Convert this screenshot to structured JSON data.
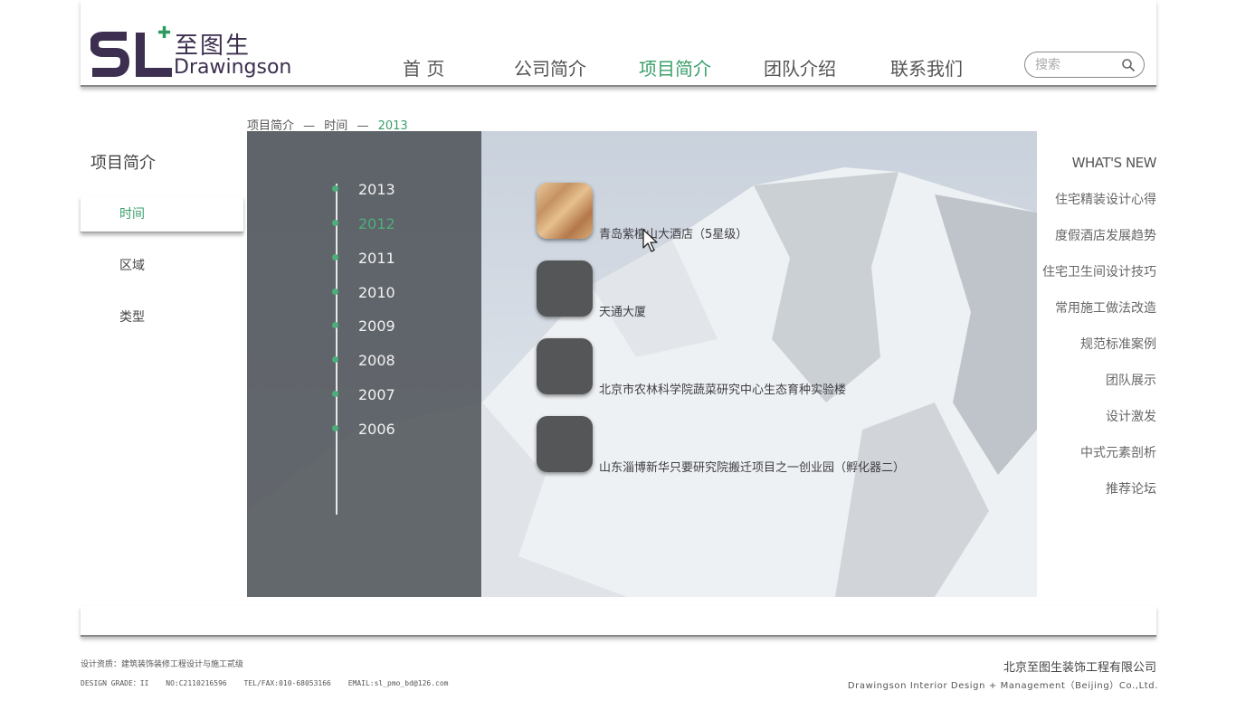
{
  "header": {
    "logo_cn": "至图生",
    "logo_en": "Drawingson",
    "nav": [
      {
        "label": "首 页"
      },
      {
        "label": "公司简介"
      },
      {
        "label": "项目简介"
      },
      {
        "label": "团队介绍"
      },
      {
        "label": "联系我们"
      }
    ],
    "active_nav": "项目简介",
    "search_placeholder": "搜索"
  },
  "breadcrumb": {
    "root": "项目简介",
    "sep": "—",
    "middle": "时间",
    "current": "2013"
  },
  "left_sidebar": {
    "title": "项目简介",
    "items": [
      {
        "label": "时间"
      },
      {
        "label": "区域"
      },
      {
        "label": "类型"
      }
    ],
    "active": "时间"
  },
  "timeline": {
    "years": [
      "2013",
      "2012",
      "2011",
      "2010",
      "2009",
      "2008",
      "2007",
      "2006"
    ],
    "highlighted": "2012"
  },
  "projects": [
    {
      "name": "青岛紫檀山大酒店（5星级）",
      "thumb": "wood"
    },
    {
      "name": "天通大厦",
      "thumb": "gray"
    },
    {
      "name": "北京市农林科学院蔬菜研究中心生态育种实验楼",
      "thumb": "gray"
    },
    {
      "name": "山东淄博新华只要研究院搬迁项目之一创业园（孵化器二）",
      "thumb": "gray"
    }
  ],
  "right_sidebar": {
    "heading": "WHAT'S NEW",
    "items": [
      "住宅精装设计心得",
      "度假酒店发展趋势",
      "住宅卫生间设计技巧",
      "常用施工做法改造",
      "规范标准案例",
      "团队展示",
      "设计激发",
      "中式元素剖析",
      "推荐论坛"
    ]
  },
  "footer": {
    "qualification": "设计资质：建筑装饰装修工程设计与施工贰级",
    "grade": "DESIGN GRADE：II",
    "no": "NO:C2110216596",
    "tel": "TEL/FAX:010-68053166",
    "email": "EMAIL:sl_pmo_bd@126.com",
    "company_cn": "北京至图生装饰工程有限公司",
    "company_en": "Drawingson Interior Design + Management（Beijing）Co.,Ltd."
  },
  "colors": {
    "accent": "#3aa06a",
    "logo": "#3d2f4f",
    "timeline_panel": "#50545a"
  }
}
